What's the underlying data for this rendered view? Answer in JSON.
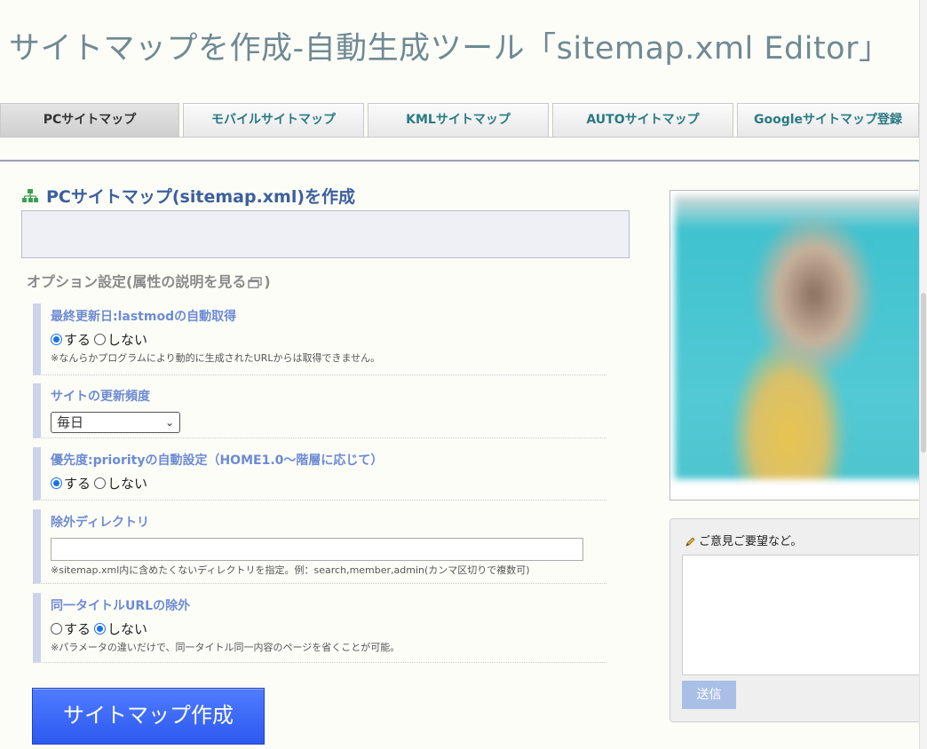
{
  "site_title": "サイトマップを作成-自動生成ツール「sitemap.xml Editor」",
  "tabs": [
    {
      "label": "PCサイトマップ",
      "active": true
    },
    {
      "label": "モバイルサイトマップ"
    },
    {
      "label": "KMLサイトマップ"
    },
    {
      "label": "AUTOサイトマップ"
    },
    {
      "label": "Googleサイトマップ登録"
    }
  ],
  "main": {
    "heading": "PCサイトマップ(sitemap.xml)を作成",
    "heading_icon": "sitemap-icon",
    "url_value": "",
    "options_title": "オプション設定(属性の説明を見る",
    "options_title_close": ")",
    "options_link_icon": "external-window-icon"
  },
  "options": {
    "lastmod": {
      "label": "最終更新日:lastmodの自動取得",
      "yes": "する",
      "no": "しない",
      "selected": "yes",
      "note": "※なんらかプログラムにより動的に生成されたURLからは取得できません。"
    },
    "changefreq": {
      "label": "サイトの更新頻度",
      "selected": "毎日"
    },
    "priority": {
      "label": "優先度:priorityの自動設定（HOME1.0〜階層に応じて）",
      "yes": "する",
      "no": "しない",
      "selected": "yes"
    },
    "exclude_dir": {
      "label": "除外ディレクトリ",
      "value": "",
      "note": "※sitemap.xml内に含めたくないディレクトリを指定。例：search,member,admin(カンマ区切りで複数可)"
    },
    "same_title": {
      "label": "同一タイトルURLの除外",
      "yes": "する",
      "no": "しない",
      "selected": "no",
      "note": "※パラメータの違いだけで、同一タイトル同一内容のページを省くことが可能。"
    }
  },
  "submit_label": "サイトマップ作成",
  "feedback": {
    "title": "ご意見ご要望など。",
    "icon": "pencil-icon",
    "send_label": "送信"
  },
  "colors": {
    "title": "#6f8a93",
    "heading": "#3c5f9e",
    "option_label": "#6d8bd4",
    "tab_text": "#2a7a84",
    "submit_bg": "#3a66f5"
  }
}
